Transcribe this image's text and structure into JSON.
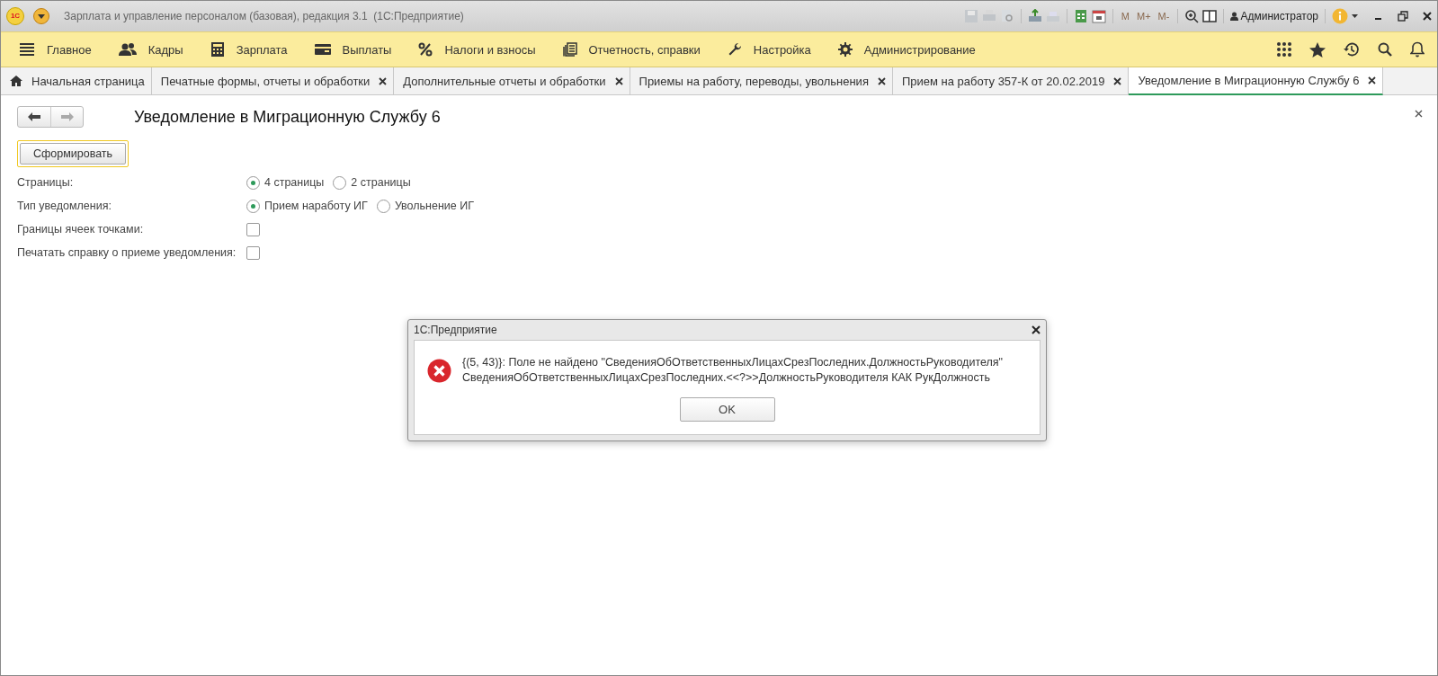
{
  "window": {
    "logo": "1С",
    "title": "Зарплата и управление персоналом (базовая), редакция 3.1  (1С:Предприятие)",
    "memory_buttons": [
      "M",
      "M+",
      "M-"
    ],
    "user": "Администратор"
  },
  "menu": {
    "items": [
      {
        "label": "Главное"
      },
      {
        "label": "Кадры"
      },
      {
        "label": "Зарплата"
      },
      {
        "label": "Выплаты"
      },
      {
        "label": "Налоги и взносы"
      },
      {
        "label": "Отчетность, справки"
      },
      {
        "label": "Настройка"
      },
      {
        "label": "Администрирование"
      }
    ]
  },
  "tabs": [
    {
      "label": "Начальная страница",
      "kind": "home",
      "selected": false
    },
    {
      "label": "Печатные формы, отчеты и обработки",
      "kind": "closable",
      "selected": false
    },
    {
      "label": "Дополнительные отчеты и обработки",
      "kind": "closable",
      "selected": false
    },
    {
      "label": "Приемы на работу, переводы, увольнения",
      "kind": "closable",
      "selected": false
    },
    {
      "label": "Прием на работу 357-К от 20.02.2019",
      "kind": "closable",
      "selected": false
    },
    {
      "label": "Уведомление в Миграционную Службу 6",
      "kind": "closable",
      "selected": true
    }
  ],
  "form": {
    "title": "Уведомление в Миграционную Службу 6",
    "generate_button": "Сформировать",
    "fields": [
      {
        "kind": "radio",
        "label": "Страницы:",
        "options": [
          {
            "label": "4 страницы",
            "selected": true
          },
          {
            "label": "2 страницы",
            "selected": false
          }
        ]
      },
      {
        "kind": "radio",
        "label": "Тип уведомления:",
        "options": [
          {
            "label": "Прием наработу ИГ",
            "selected": true
          },
          {
            "label": "Увольнение ИГ",
            "selected": false
          }
        ]
      },
      {
        "kind": "checkbox",
        "label": "Границы ячеек точками:",
        "checked": false
      },
      {
        "kind": "checkbox",
        "label": "Печатать справку о приеме уведомления:",
        "checked": false
      }
    ]
  },
  "dialog": {
    "title": "1С:Предприятие",
    "message_lines": [
      "{(5, 43)}: Поле не найдено \"СведенияОбОтветственныхЛицахСрезПоследних.ДолжностьРуководителя\"",
      "СведенияОбОтветственныхЛицахСрезПоследних.<<?>>ДолжностьРуководителя КАК РукДолжность"
    ],
    "button": "OK"
  }
}
